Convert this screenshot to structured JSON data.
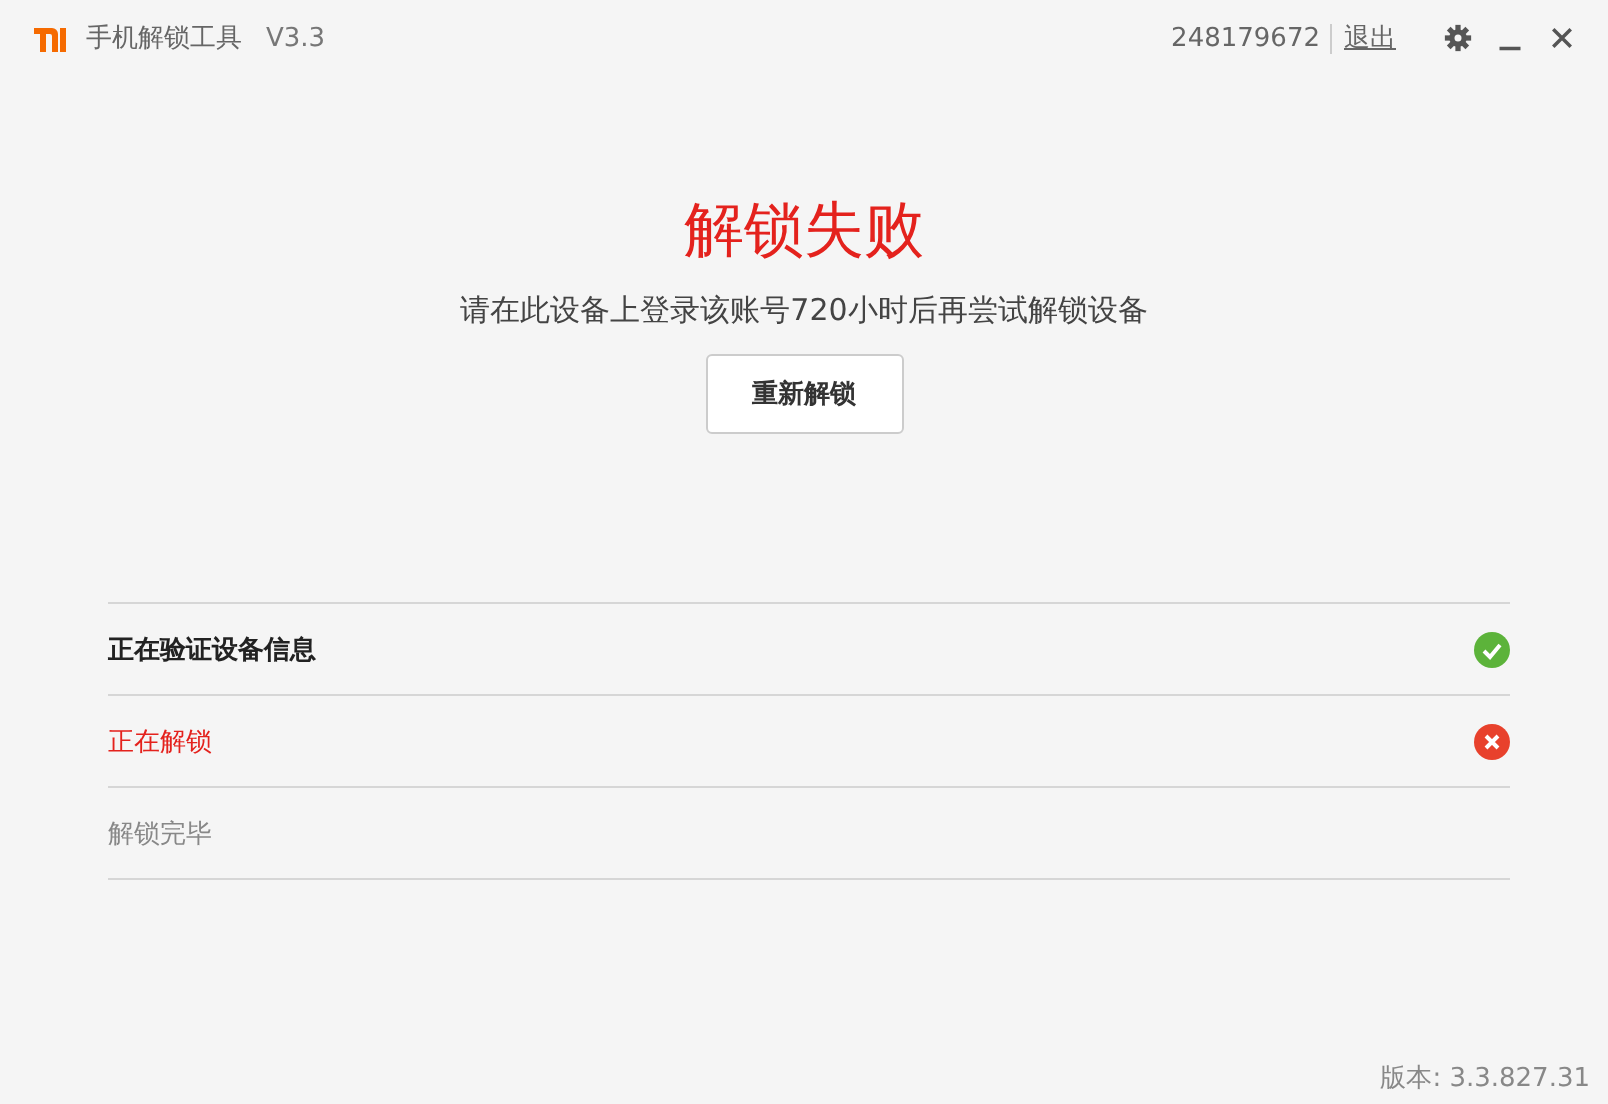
{
  "header": {
    "app_name": "手机解锁工具",
    "version": "V3.3",
    "account": "248179672",
    "logout": "退出"
  },
  "result": {
    "title": "解锁失败",
    "message": "请在此设备上登录该账号720小时后再尝试解锁设备",
    "button": "重新解锁"
  },
  "steps": [
    {
      "label": "正在验证设备信息",
      "kind": "done"
    },
    {
      "label": "正在解锁",
      "kind": "failed"
    },
    {
      "label": "解锁完毕",
      "kind": "pending"
    }
  ],
  "footer": {
    "version": "版本: 3.3.827.31"
  }
}
